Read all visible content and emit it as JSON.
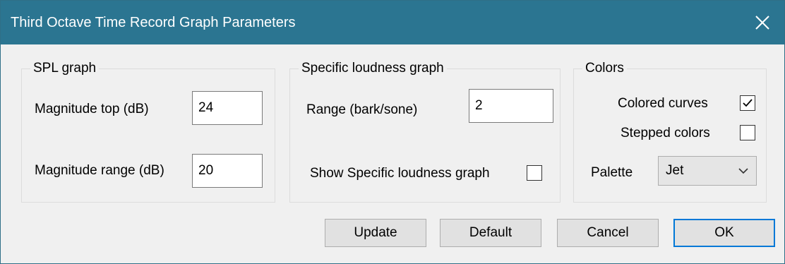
{
  "window": {
    "title": "Third Octave Time Record Graph Parameters"
  },
  "spl_graph": {
    "title": "SPL graph",
    "magnitude_top_label": "Magnitude top (dB)",
    "magnitude_top_value": "24",
    "magnitude_range_label": "Magnitude range (dB)",
    "magnitude_range_value": "20"
  },
  "specific_loudness": {
    "title": "Specific loudness graph",
    "range_label": "Range (bark/sone)",
    "range_value": "2",
    "show_label": "Show Specific loudness graph",
    "show_checked": false
  },
  "colors": {
    "title": "Colors",
    "colored_curves_label": "Colored curves",
    "colored_curves_checked": true,
    "stepped_colors_label": "Stepped colors",
    "stepped_colors_checked": false,
    "palette_label": "Palette",
    "palette_value": "Jet"
  },
  "buttons": {
    "update": "Update",
    "default": "Default",
    "cancel": "Cancel",
    "ok": "OK"
  },
  "theme": {
    "titlebar_color": "#2b7591",
    "focus_color": "#0078d7"
  },
  "icons": {
    "close": "close-icon",
    "check": "checkmark-icon",
    "dropdown": "chevron-down-icon"
  }
}
